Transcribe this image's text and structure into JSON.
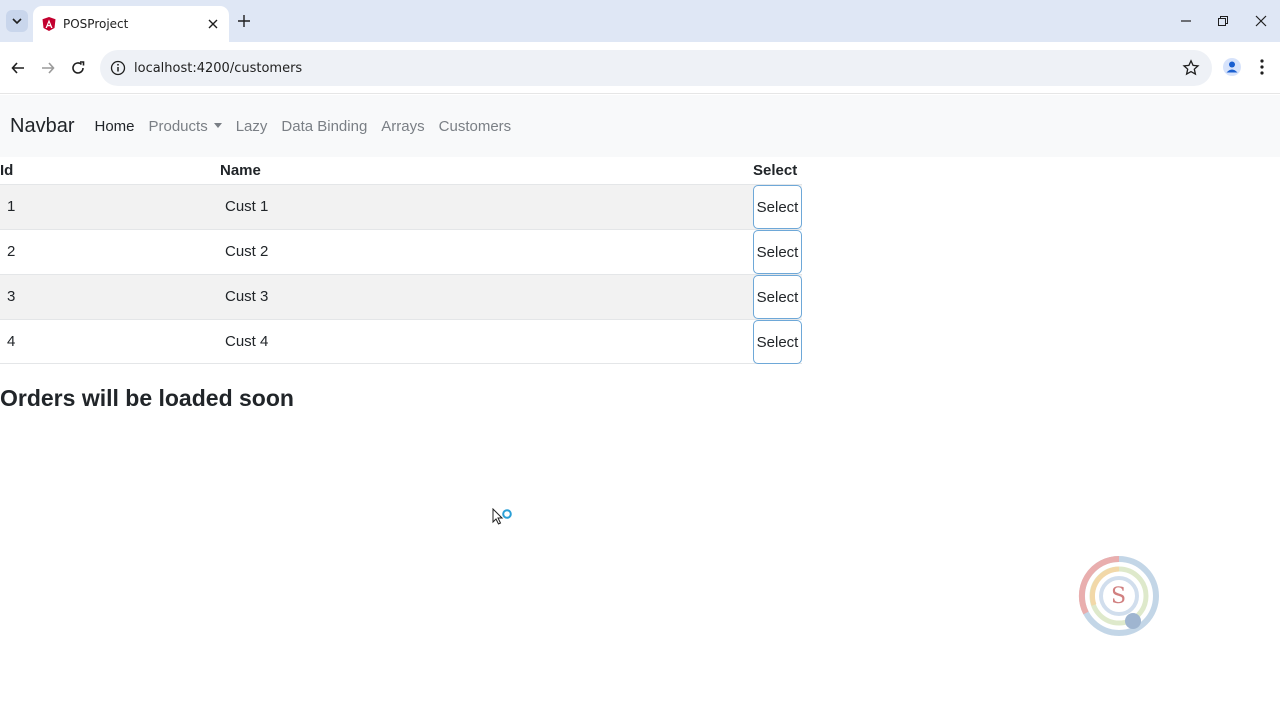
{
  "browser": {
    "tab_title": "POSProject",
    "url": "localhost:4200/customers"
  },
  "navbar": {
    "brand": "Navbar",
    "links": [
      "Home",
      "Products",
      "Lazy",
      "Data Binding",
      "Arrays",
      "Customers"
    ]
  },
  "table": {
    "headers": {
      "id": "Id",
      "name": "Name",
      "select": "Select"
    },
    "rows": [
      {
        "id": "1",
        "name": "Cust 1",
        "action": "Select"
      },
      {
        "id": "2",
        "name": "Cust 2",
        "action": "Select"
      },
      {
        "id": "3",
        "name": "Cust 3",
        "action": "Select"
      },
      {
        "id": "4",
        "name": "Cust 4",
        "action": "Select"
      }
    ]
  },
  "orders": {
    "heading": "Orders will be loaded soon"
  },
  "icons": {
    "tab_search": "chevron-down-icon",
    "favicon": "angular-icon",
    "close": "close-icon",
    "new_tab": "plus-icon",
    "back": "back-arrow-icon",
    "forward": "forward-arrow-icon",
    "reload": "reload-icon",
    "site_info": "info-icon",
    "bookmark": "star-icon",
    "profile": "profile-icon",
    "menu": "kebab-menu-icon",
    "cursor": "busy-cursor-icon",
    "watermark": "watermark-logo-icon"
  },
  "colors": {
    "tabstrip": "#dfe7f5",
    "navbar_bg": "#f8f9fa",
    "select_border": "#6ea8d8",
    "stripe": "#f2f2f2"
  }
}
